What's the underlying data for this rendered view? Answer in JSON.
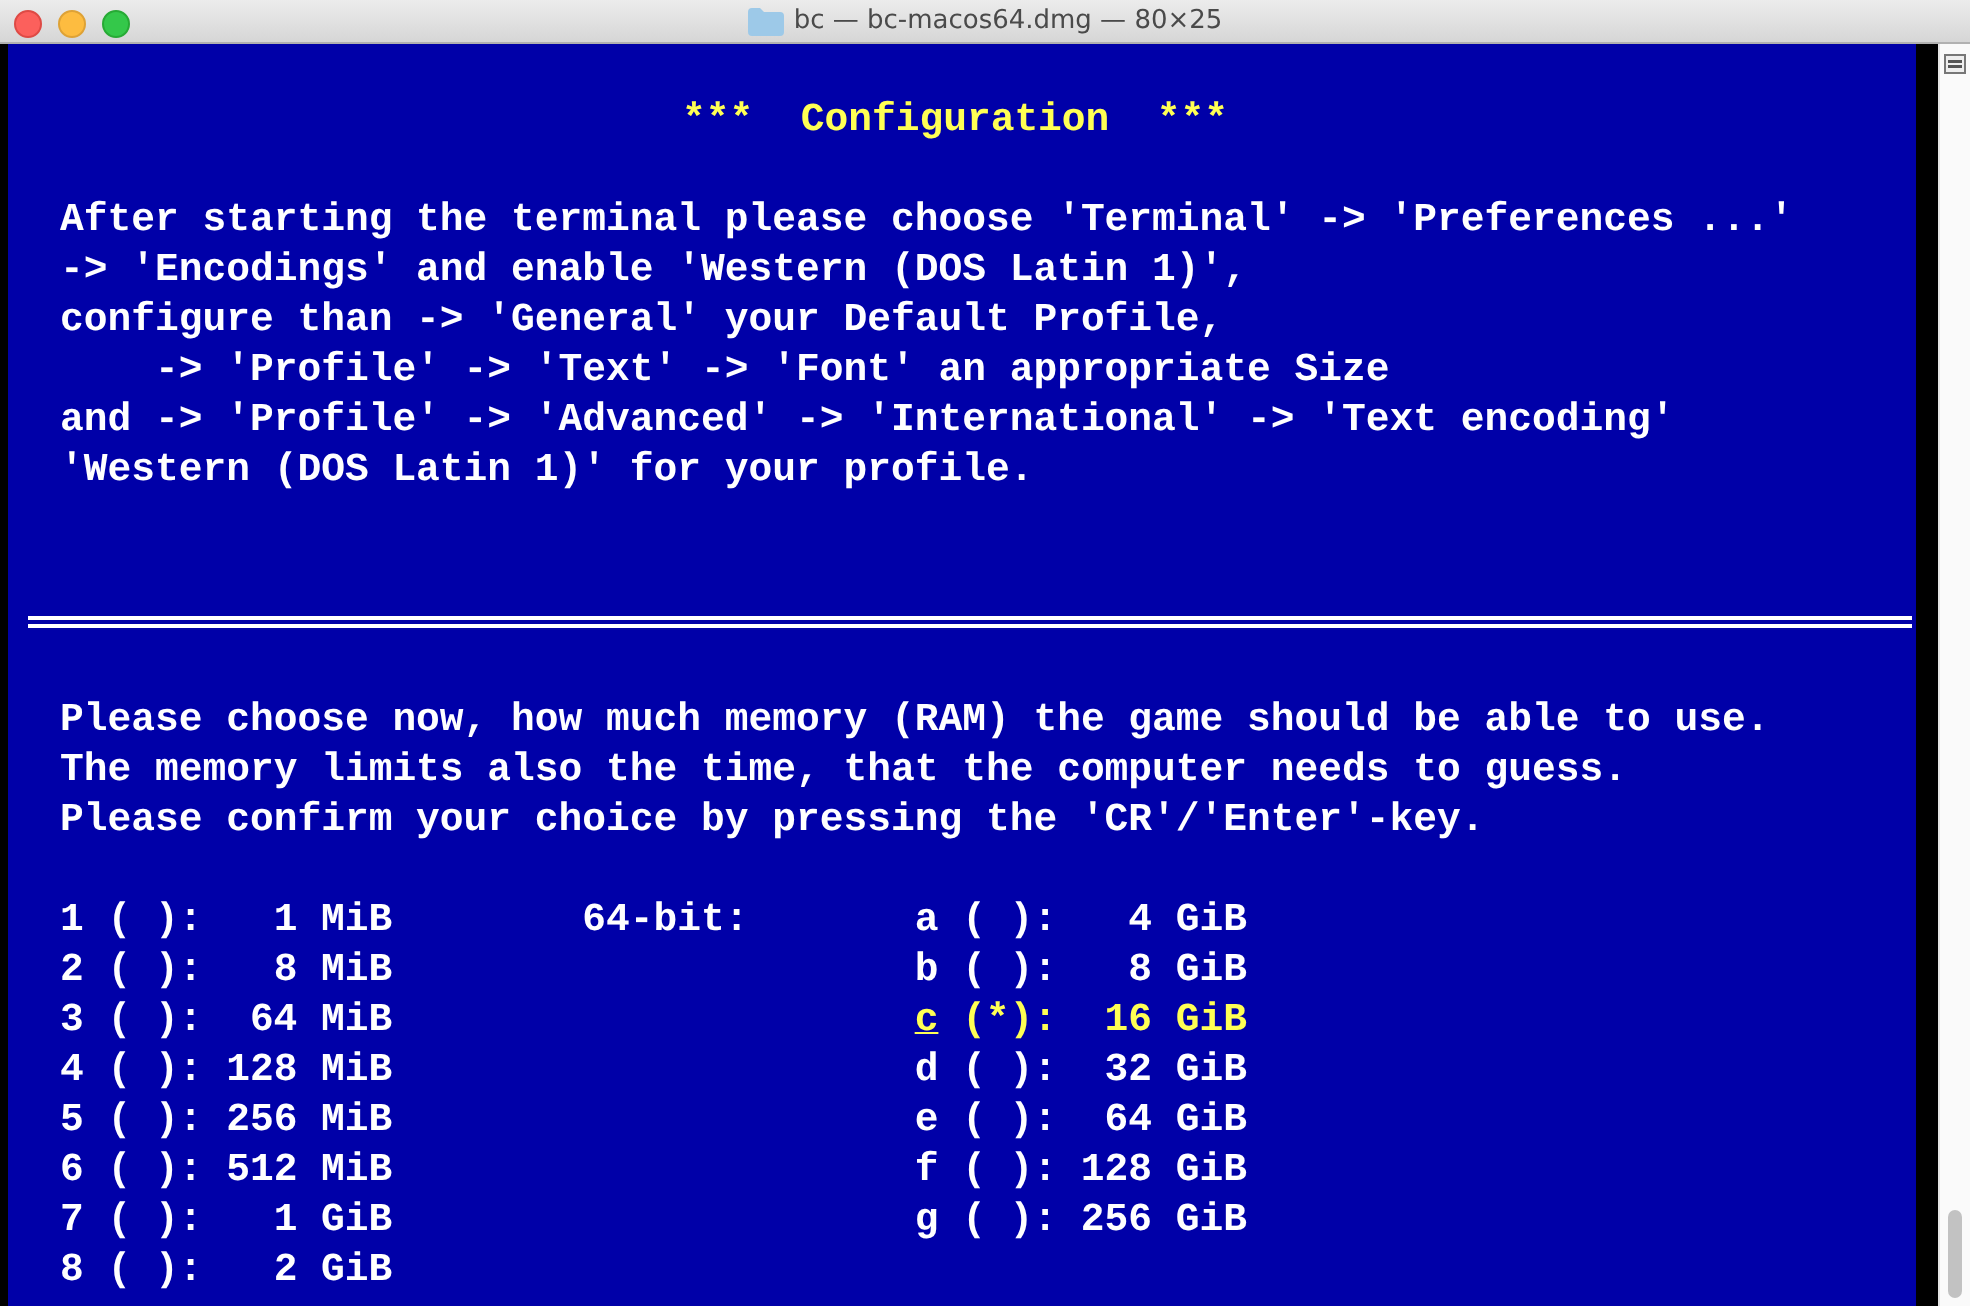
{
  "window": {
    "title": "bc — bc-macos64.dmg — 80×25"
  },
  "terminal": {
    "heading": "***  Configuration  ***",
    "instructions": [
      "After starting the terminal please choose 'Terminal' -> 'Preferences ...'",
      "-> 'Encodings' and enable 'Western (DOS Latin 1)',",
      "configure than -> 'General' your Default Profile,",
      "    -> 'Profile' -> 'Text' -> 'Font' an appropriate Size",
      "and -> 'Profile' -> 'Advanced' -> 'International' -> 'Text encoding'",
      "'Western (DOS Latin 1)' for your profile."
    ],
    "prompt": [
      "Please choose now, how much memory (RAM) the game should be able to use.",
      "The memory limits also the time, that the computer needs to guess.",
      "Please confirm your choice by pressing the 'CR'/'Enter'-key."
    ],
    "left_options": [
      {
        "key": "1",
        "marker": "( ):",
        "size": "1 MiB",
        "selected": false
      },
      {
        "key": "2",
        "marker": "( ):",
        "size": "8 MiB",
        "selected": false
      },
      {
        "key": "3",
        "marker": "( ):",
        "size": "64 MiB",
        "selected": false
      },
      {
        "key": "4",
        "marker": "( ):",
        "size": "128 MiB",
        "selected": false
      },
      {
        "key": "5",
        "marker": "( ):",
        "size": "256 MiB",
        "selected": false
      },
      {
        "key": "6",
        "marker": "( ):",
        "size": "512 MiB",
        "selected": false
      },
      {
        "key": "7",
        "marker": "( ):",
        "size": "1 GiB",
        "selected": false
      },
      {
        "key": "8",
        "marker": "( ):",
        "size": "2 GiB",
        "selected": false
      }
    ],
    "bits_label": "64-bit:",
    "right_options": [
      {
        "key": "a",
        "marker": "( ):",
        "size": "4 GiB",
        "selected": false
      },
      {
        "key": "b",
        "marker": "( ):",
        "size": "8 GiB",
        "selected": false
      },
      {
        "key": "c",
        "marker": "(*):",
        "size": "16 GiB",
        "selected": true
      },
      {
        "key": "d",
        "marker": "( ):",
        "size": "32 GiB",
        "selected": false
      },
      {
        "key": "e",
        "marker": "( ):",
        "size": "64 GiB",
        "selected": false
      },
      {
        "key": "f",
        "marker": "( ):",
        "size": "128 GiB",
        "selected": false
      },
      {
        "key": "g",
        "marker": "( ):",
        "size": "256 GiB",
        "selected": false
      }
    ]
  }
}
